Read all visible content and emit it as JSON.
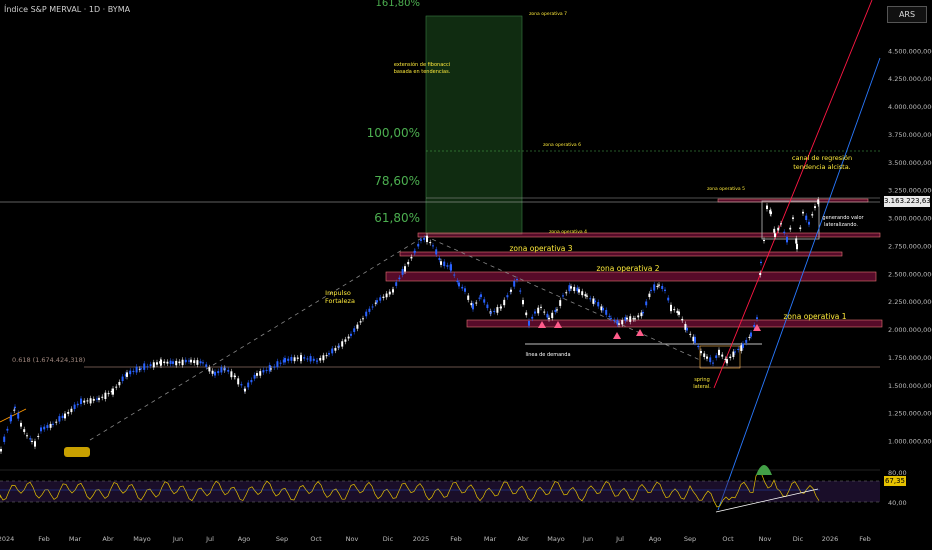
{
  "header": {
    "title": "Índice S&P MERVAL · 1D · BYMA",
    "currency": "ARS"
  },
  "price_tag": "3.163.223,630",
  "rsi_tags": {
    "upper": "80,00",
    "value": "67,35",
    "lower": "40,00"
  },
  "colors": {
    "bg": "#000000",
    "up": "#ffffff",
    "down": "#2962ff",
    "zone": "#c2185b",
    "fib": "#2e7d32",
    "text_yellow": "#ffeb3b",
    "channel_red": "#ff1744",
    "channel_blue": "#2979ff"
  },
  "chart_data": {
    "type": "candlestick",
    "title": "Índice S&P MERVAL · 1D · BYMA",
    "y_axis": {
      "labels": [
        "4.500.000,000",
        "4.250.000,000",
        "4.000.000,000",
        "3.750.000,000",
        "3.500.000,000",
        "3.250.000,000",
        "3.000.000,000",
        "2.750.000,000",
        "2.500.000,000",
        "2.250.000,000",
        "2.000.000,000",
        "1.750.000,000",
        "1.500.000,000",
        "1.250.000,000",
        "1.000.000,000"
      ],
      "values": [
        4500000,
        4250000,
        4000000,
        3750000,
        3500000,
        3250000,
        3000000,
        2750000,
        2500000,
        2250000,
        2000000,
        1750000,
        1500000,
        1250000,
        1000000
      ],
      "ylim": [
        900000,
        5000000
      ]
    },
    "x_axis": {
      "labels": [
        "2024",
        "Feb",
        "Mar",
        "Abr",
        "Mayo",
        "Jun",
        "Jul",
        "Ago",
        "Sep",
        "Oct",
        "Nov",
        "Dic",
        "2025",
        "Feb",
        "Mar",
        "Abr",
        "Mayo",
        "Jun",
        "Jul",
        "Ago",
        "Sep",
        "Oct",
        "Nov",
        "Dic",
        "2026",
        "Feb"
      ]
    },
    "series": [
      {
        "points": [
          [
            0,
            920000
          ],
          [
            10,
            1200000
          ],
          [
            14,
            1300000
          ],
          [
            20,
            1150000
          ],
          [
            26,
            1050000
          ],
          [
            31,
            1000000
          ],
          [
            34,
            980000
          ],
          [
            40,
            1100000
          ],
          [
            52,
            1150000
          ],
          [
            64,
            1230000
          ],
          [
            80,
            1350000
          ],
          [
            98,
            1380000
          ],
          [
            112,
            1450000
          ],
          [
            126,
            1600000
          ],
          [
            140,
            1650000
          ],
          [
            160,
            1710000
          ],
          [
            172,
            1700000
          ],
          [
            190,
            1720000
          ],
          [
            202,
            1700000
          ],
          [
            214,
            1600000
          ],
          [
            224,
            1650000
          ],
          [
            234,
            1580000
          ],
          [
            244,
            1460000
          ],
          [
            256,
            1600000
          ],
          [
            270,
            1650000
          ],
          [
            284,
            1720000
          ],
          [
            300,
            1750000
          ],
          [
            316,
            1720000
          ],
          [
            328,
            1780000
          ],
          [
            338,
            1850000
          ],
          [
            350,
            1950000
          ],
          [
            362,
            2100000
          ],
          [
            376,
            2250000
          ],
          [
            392,
            2350000
          ],
          [
            404,
            2550000
          ],
          [
            414,
            2700000
          ],
          [
            420,
            2800000
          ],
          [
            426,
            2820000
          ],
          [
            432,
            2750000
          ],
          [
            440,
            2600000
          ],
          [
            450,
            2550000
          ],
          [
            458,
            2400000
          ],
          [
            464,
            2350000
          ],
          [
            472,
            2200000
          ],
          [
            480,
            2300000
          ],
          [
            490,
            2150000
          ],
          [
            500,
            2200000
          ],
          [
            510,
            2350000
          ],
          [
            516,
            2450000
          ],
          [
            522,
            2250000
          ],
          [
            528,
            2050000
          ],
          [
            534,
            2150000
          ],
          [
            540,
            2200000
          ],
          [
            548,
            2100000
          ],
          [
            556,
            2180000
          ],
          [
            562,
            2300000
          ],
          [
            570,
            2380000
          ],
          [
            578,
            2350000
          ],
          [
            586,
            2300000
          ],
          [
            594,
            2250000
          ],
          [
            602,
            2180000
          ],
          [
            610,
            2100000
          ],
          [
            618,
            2050000
          ],
          [
            626,
            2100000
          ],
          [
            634,
            2100000
          ],
          [
            642,
            2150000
          ],
          [
            650,
            2350000
          ],
          [
            658,
            2400000
          ],
          [
            664,
            2350000
          ],
          [
            670,
            2200000
          ],
          [
            678,
            2150000
          ],
          [
            686,
            2000000
          ],
          [
            694,
            1900000
          ],
          [
            700,
            1800000
          ],
          [
            706,
            1750000
          ],
          [
            712,
            1700000
          ],
          [
            718,
            1800000
          ],
          [
            726,
            1720000
          ],
          [
            734,
            1800000
          ],
          [
            742,
            1850000
          ],
          [
            750,
            1950000
          ],
          [
            756,
            2100000
          ],
          [
            760,
            2600000
          ],
          [
            763,
            2800000
          ],
          [
            766,
            3100000
          ],
          [
            770,
            3050000
          ],
          [
            774,
            2850000
          ],
          [
            780,
            2950000
          ],
          [
            786,
            2800000
          ],
          [
            792,
            3000000
          ],
          [
            796,
            2750000
          ],
          [
            802,
            3050000
          ],
          [
            808,
            2950000
          ],
          [
            814,
            3100000
          ],
          [
            818,
            3163223
          ]
        ]
      }
    ],
    "fib_levels": [
      "161,80%",
      "100,00%",
      "78,60%",
      "61,80%"
    ],
    "rsi": {
      "levels": [
        "80,00",
        "40,00"
      ],
      "value": "67,35"
    },
    "annotations": [
      "zona operativa 7",
      "extensión de fibonacci basada en tendencias.",
      "zona operativa 6",
      "zona operativa 5",
      "zona operativa 4",
      "zona operativa 3",
      "zona operativa 2",
      "zona operativa 1",
      "Impulso Fortaleza",
      "linea de demanda",
      "spring lateral.",
      "canal de regresión tendencia alcista.",
      "generando valor lateralizando.",
      "0.618 (1.674.424,318)"
    ]
  }
}
